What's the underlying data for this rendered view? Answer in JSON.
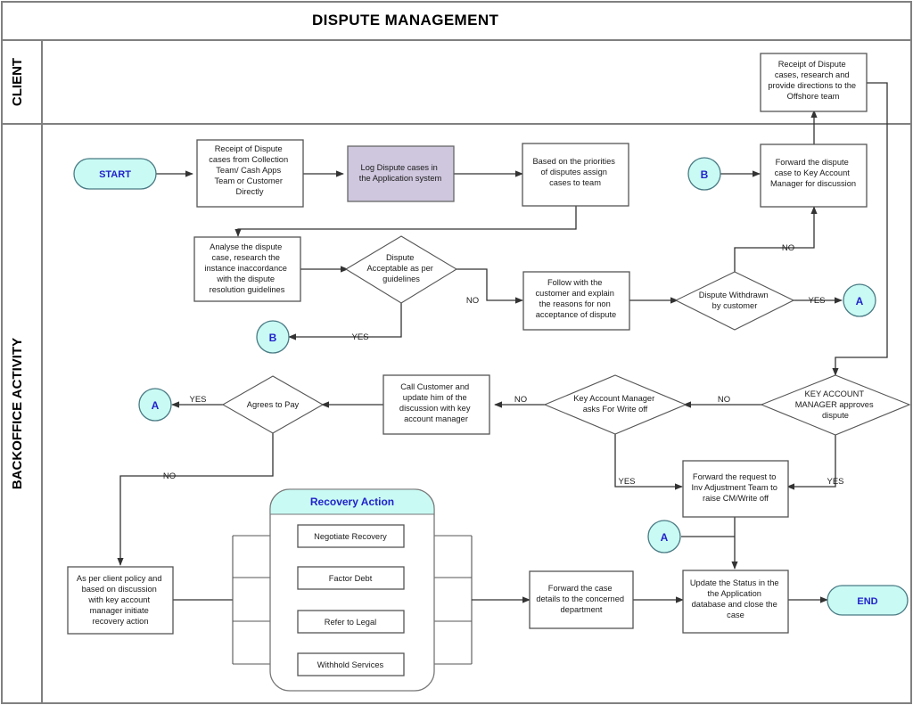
{
  "title": "DISPUTE MANAGEMENT",
  "lanes": [
    {
      "id": "client",
      "label": "CLIENT"
    },
    {
      "id": "backoffice",
      "label": "BACKOFFICE ACTIVITY"
    }
  ],
  "nodes": {
    "start": {
      "label": "START",
      "type": "terminator"
    },
    "receipt_collection": {
      "label": "Receipt of Dispute cases from Collection Team/ Cash Apps Team or Customer Directly",
      "type": "process"
    },
    "log_dispute": {
      "label": "Log Dispute cases in the Application system",
      "type": "process-alt"
    },
    "assign_cases": {
      "label": "Based on the priorities of disputes assign cases to team",
      "type": "process"
    },
    "connector_b_top": {
      "label": "B",
      "type": "connector"
    },
    "forward_kam": {
      "label": "Forward the dispute case to Key Account Manager for discussion",
      "type": "process"
    },
    "client_receipt": {
      "label": "Receipt of Dispute cases, research and provide directions to the Offshore team",
      "type": "process"
    },
    "analyse_dispute": {
      "label": "Analyse the dispute case, research the instance inaccordance with the dispute resolution guidelines",
      "type": "process"
    },
    "dispute_acceptable": {
      "label": "Dispute Acceptable as per guidelines",
      "type": "decision"
    },
    "connector_b_mid": {
      "label": "B",
      "type": "connector"
    },
    "follow_customer": {
      "label": "Follow with the customer and explain the reasons for non acceptance of dispute",
      "type": "process"
    },
    "dispute_withdrawn": {
      "label": "Dispute Withdrawn by customer",
      "type": "decision"
    },
    "connector_a_right": {
      "label": "A",
      "type": "connector"
    },
    "kam_approves": {
      "label": "KEY ACCOUNT MANAGER approves dispute",
      "type": "decision"
    },
    "kam_writeoff": {
      "label": "Key Account Manager asks For Write off",
      "type": "decision"
    },
    "call_customer": {
      "label": "Call Customer and update him of the discussion with key account manager",
      "type": "process"
    },
    "agrees_to_pay": {
      "label": "Agrees to Pay",
      "type": "decision"
    },
    "connector_a_left": {
      "label": "A",
      "type": "connector"
    },
    "forward_inv": {
      "label": "Forward the request to Inv Adjustment Team to raise CM/Write off",
      "type": "process"
    },
    "connector_a_bottom": {
      "label": "A",
      "type": "connector"
    },
    "client_policy": {
      "label": "As per client policy and based on discussion with key account manager initiate recovery action",
      "type": "process"
    },
    "recovery_group": {
      "label": "Recovery Action",
      "type": "group"
    },
    "negotiate_recovery": {
      "label": "Negotiate Recovery",
      "type": "process"
    },
    "factor_debt": {
      "label": "Factor Debt",
      "type": "process"
    },
    "refer_legal": {
      "label": "Refer to Legal",
      "type": "process"
    },
    "withhold_services": {
      "label": "Withhold Services",
      "type": "process"
    },
    "forward_case": {
      "label": "Forward the case details to the concerned department",
      "type": "process"
    },
    "update_status": {
      "label": "Update the Status in the the Application database and close the case",
      "type": "process"
    },
    "end": {
      "label": "END",
      "type": "terminator"
    }
  },
  "edge_labels": {
    "acceptable_no": "NO",
    "acceptable_yes": "YES",
    "withdrawn_yes": "YES",
    "withdrawn_no": "NO",
    "kam_approves_no": "NO",
    "kam_approves_yes": "YES",
    "writeoff_no": "NO",
    "writeoff_yes": "YES",
    "agrees_yes": "YES",
    "agrees_no": "NO"
  },
  "colors": {
    "terminator_fill": "#c9fbf4",
    "terminator_text": "#2222cc",
    "process_alt_fill": "#cfc7de",
    "lane_border": "#808080",
    "edge": "#333333",
    "group_header_fill": "#c9fbf4"
  }
}
